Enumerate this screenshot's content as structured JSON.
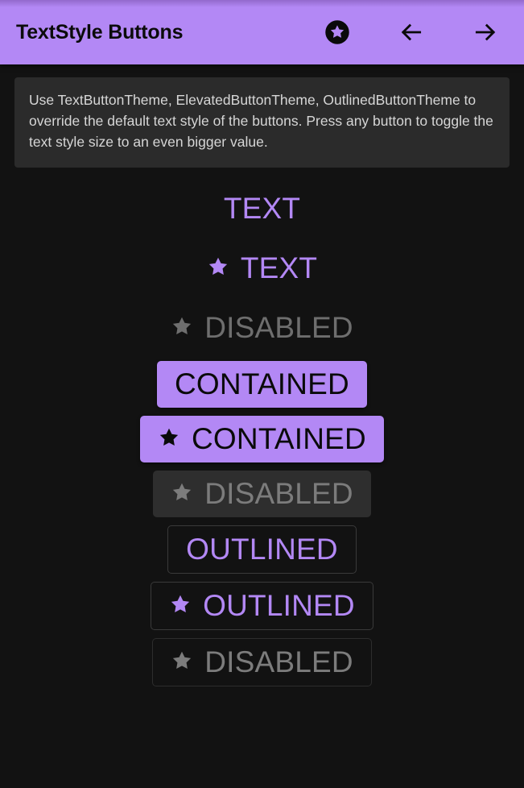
{
  "app": {
    "background_color": "#121212",
    "accent_color": "#b388f5",
    "disabled_color": "#7c7c7c"
  },
  "appbar": {
    "title": "TextStyle Buttons",
    "background_color": "#b388f5",
    "title_color": "#0b0b0b",
    "actions": [
      {
        "icon": "star-circle-icon",
        "label": ""
      },
      {
        "icon": "arrow-left-icon",
        "label": ""
      },
      {
        "icon": "arrow-right-icon",
        "label": ""
      }
    ]
  },
  "info": {
    "text": "Use TextButtonTheme, ElevatedButtonTheme, OutlinedButtonTheme to override the default text style of the buttons. Press any button to toggle the text style size to an even bigger value.",
    "background_color": "#2b2b2b",
    "text_color": "#d6d6d6"
  },
  "buttons": [
    {
      "label": "TEXT",
      "kind": "text",
      "icon": null,
      "disabled": false
    },
    {
      "label": "TEXT",
      "kind": "text",
      "icon": "star-icon",
      "disabled": false
    },
    {
      "label": "DISABLED",
      "kind": "text",
      "icon": "star-icon",
      "disabled": true
    },
    {
      "label": "CONTAINED",
      "kind": "contained",
      "icon": null,
      "disabled": false
    },
    {
      "label": "CONTAINED",
      "kind": "contained",
      "icon": "star-icon",
      "disabled": false
    },
    {
      "label": "DISABLED",
      "kind": "contained",
      "icon": "star-icon",
      "disabled": true
    },
    {
      "label": "OUTLINED",
      "kind": "outlined",
      "icon": null,
      "disabled": false
    },
    {
      "label": "OUTLINED",
      "kind": "outlined",
      "icon": "star-icon",
      "disabled": false
    },
    {
      "label": "DISABLED",
      "kind": "outlined",
      "icon": "star-icon",
      "disabled": true
    }
  ]
}
